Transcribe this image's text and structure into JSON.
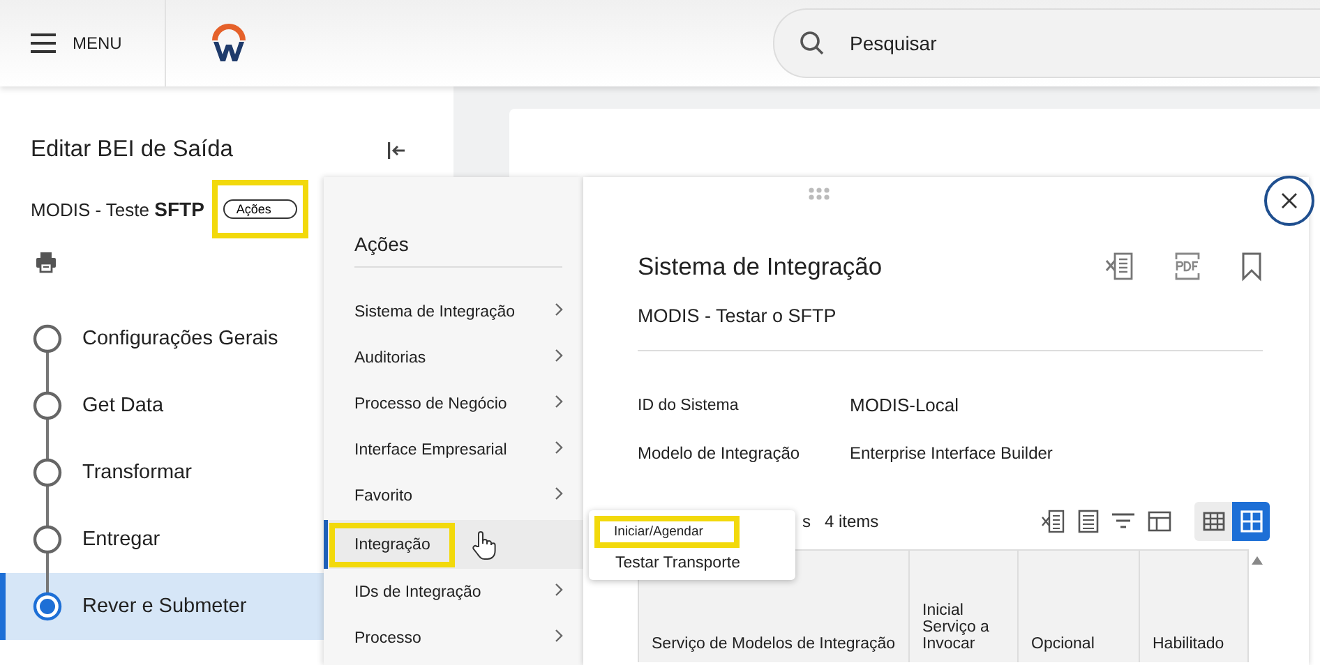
{
  "header": {
    "menu_label": "MENU",
    "search_placeholder": "Pesquisar"
  },
  "sidebar": {
    "title": "Editar BEI de Saída",
    "subtitle": "MODIS - Teste **SFTP**",
    "actions_button": {
      "label": "Ações",
      "highlighted": true
    },
    "steps": [
      {
        "label": "Configurações Gerais",
        "selected": false
      },
      {
        "label": "Get Data",
        "selected": false
      },
      {
        "label": "Transformar",
        "selected": false
      },
      {
        "label": "Entregar",
        "selected": false
      },
      {
        "label": "Rever e Submeter",
        "selected": true
      }
    ]
  },
  "actions_menu": {
    "title": "Ações",
    "items": [
      {
        "label": "Sistema de Integração",
        "has_submenu": true,
        "selected": false,
        "highlighted": false
      },
      {
        "label": "Auditorias",
        "has_submenu": true,
        "selected": false,
        "highlighted": false
      },
      {
        "label": "Processo de Negócio",
        "has_submenu": true,
        "selected": false,
        "highlighted": false
      },
      {
        "label": "Interface Empresarial",
        "has_submenu": true,
        "selected": false,
        "highlighted": false
      },
      {
        "label": "Favorito",
        "has_submenu": true,
        "selected": false,
        "highlighted": false
      },
      {
        "label": "Integração",
        "has_submenu": false,
        "selected": true,
        "highlighted": true
      },
      {
        "label": "IDs de Integração",
        "has_submenu": true,
        "selected": false,
        "highlighted": false
      },
      {
        "label": "Processo",
        "has_submenu": true,
        "selected": false,
        "highlighted": false
      }
    ]
  },
  "submenu": {
    "items": [
      {
        "label": "Iniciar/Agendar",
        "highlighted": true
      },
      {
        "label": "Testar Transporte",
        "highlighted": false
      }
    ]
  },
  "panel": {
    "title": "Sistema de Integração",
    "subtitle": "MODIS - Testar o SFTP",
    "fields": [
      {
        "label": "ID do Sistema",
        "value": "MODIS-Local"
      },
      {
        "label": "Modelo de Integração",
        "value": "Enterprise Interface Builder"
      }
    ],
    "table": {
      "caption": "s",
      "count": "4 items",
      "view_toggles": [
        {
          "selected": false
        },
        {
          "selected": true
        }
      ],
      "columns": [
        "Serviço de Modelos de Integração",
        "Inicial Serviço a Invocar",
        "Opcional",
        "Habilitado"
      ]
    }
  }
}
